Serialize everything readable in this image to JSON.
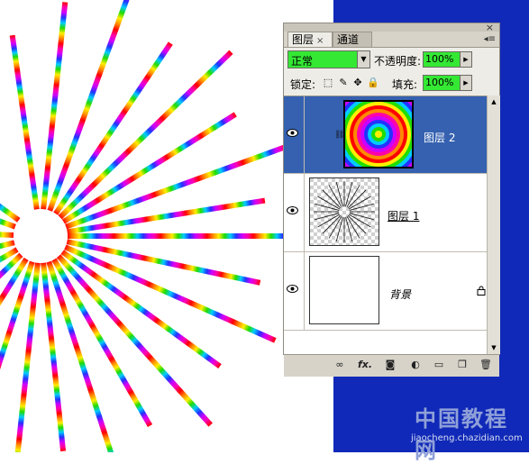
{
  "layers_panel": {
    "tabs": [
      {
        "label": "图层",
        "close": "×",
        "active": true
      },
      {
        "label": "通道",
        "active": false
      }
    ],
    "close_glyph": "×",
    "menu_glyph": "◂≡",
    "blend_mode": "正常",
    "opacity_label": "不透明度:",
    "opacity_value": "100%",
    "lock_label": "锁定:",
    "fill_label": "填充:",
    "fill_value": "100%",
    "layers": [
      {
        "name": "图层 2",
        "visible": true,
        "selected": true
      },
      {
        "name": "图层 1",
        "visible": true,
        "selected": false
      },
      {
        "name": "背景",
        "visible": true,
        "selected": false,
        "locked": true
      }
    ],
    "footer_icons": [
      "link-icon",
      "fx-icon",
      "mask-icon",
      "adjustment-icon",
      "group-folder-icon",
      "new-layer-icon",
      "trash-icon"
    ],
    "fx_label": "fx."
  },
  "watermark": {
    "text": "中国教程网",
    "url": "jiaocheng.chazidian.com"
  },
  "colors": {
    "blue_background": "#1029b8",
    "selected_layer": "#3561b0",
    "field_green": "#34e834"
  }
}
